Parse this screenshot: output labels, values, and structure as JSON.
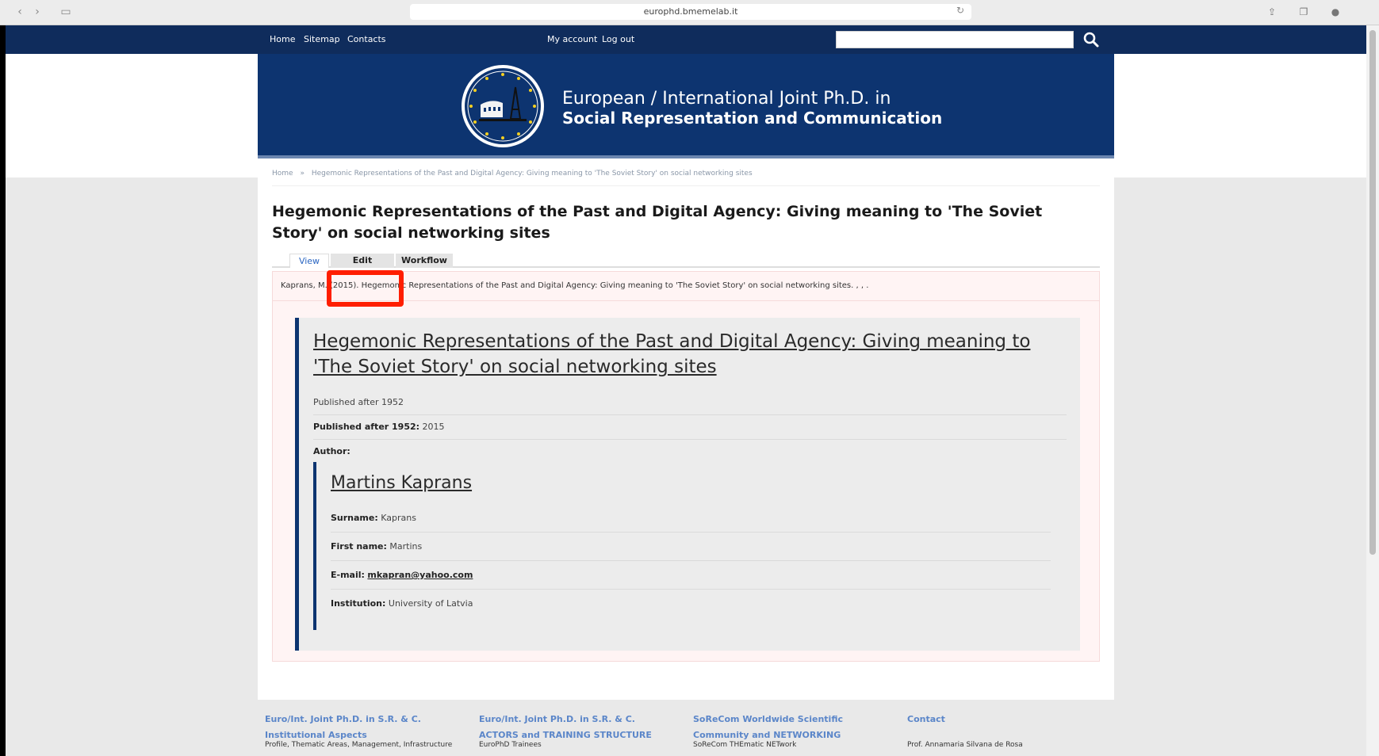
{
  "browser": {
    "url": "europhd.bmemelab.it"
  },
  "topbar": {
    "links": [
      "Home",
      "Sitemap",
      "Contacts"
    ],
    "account_links": [
      "My account",
      "Log out"
    ],
    "search_placeholder": ""
  },
  "banner": {
    "line1": "European / International Joint Ph.D. in",
    "line2": "Social Representation and Communication"
  },
  "breadcrumb": {
    "home": "Home",
    "separator": "»",
    "current": "Hegemonic Representations of the Past and Digital Agency: Giving meaning to 'The Soviet Story' on social networking sites"
  },
  "page": {
    "title": "Hegemonic Representations of the Past and Digital Agency: Giving meaning to 'The Soviet Story' on social networking sites"
  },
  "tabs": {
    "view": "View",
    "edit": "Edit",
    "workflow": "Workflow"
  },
  "citation": "Kaprans, M. (2015). Hegemonic Representations of the Past and Digital Agency: Giving meaning to 'The Soviet Story' on social networking sites. , , .",
  "record": {
    "title": "Hegemonic Representations of the Past and Digital Agency: Giving meaning to 'The Soviet Story' on social networking sites",
    "field_heading": "Published after 1952",
    "published_label": "Published after 1952:",
    "published_value": "2015",
    "author_label": "Author:",
    "author": {
      "name": "Martins Kaprans",
      "surname_label": "Surname:",
      "surname": "Kaprans",
      "first_name_label": "First name:",
      "first_name": "Martins",
      "email_label": "E-mail:",
      "email": "mkapran@yahoo.com",
      "institution_label": "Institution:",
      "institution": "University of Latvia"
    }
  },
  "footer": {
    "col1_head": "Euro/Int. Joint Ph.D. in S.R. & C. Institutional Aspects",
    "col1_sub": "Profile, Thematic Areas, Management, Infrastructure",
    "col2_head": "Euro/Int. Joint Ph.D. in S.R. & C. ACTORS and TRAINING STRUCTURE",
    "col2_sub": "EuroPhD Trainees",
    "col3_head": "SoReCom Worldwide Scientific Community and NETWORKING",
    "col3_sub": "SoReCom THEmatic NETwork",
    "col4_head": "Contact",
    "col4_sub": "Prof. Annamaria Silvana de Rosa"
  },
  "colors": {
    "navy": "#0f2c5c",
    "banner": "#0d3470",
    "highlight": "#ff1e00",
    "link_blue": "#5b86c9"
  }
}
